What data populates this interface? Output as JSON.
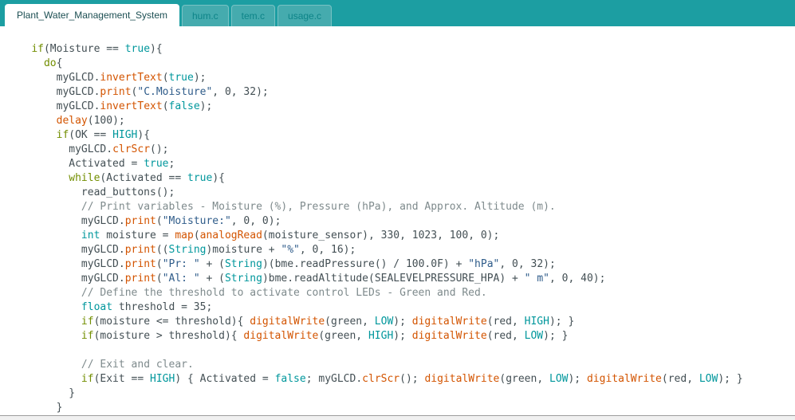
{
  "tabbar": {
    "tabs": [
      {
        "label": "Plant_Water_Management_System",
        "active": true
      },
      {
        "label": "hum.c",
        "active": false
      },
      {
        "label": "tem.c",
        "active": false
      },
      {
        "label": "usage.c",
        "active": false
      }
    ]
  },
  "colors": {
    "tabbar_bg": "#1C9EA2",
    "tab_active_bg": "#FFFFFF",
    "tab_active_text": "#1B4E52",
    "tab_inactive_bg": "#45ABAE",
    "tab_inactive_text": "#0D8488",
    "syntax": {
      "plain": "#434F54",
      "keyword": "#728E00",
      "type_literal": "#00979C",
      "function": "#D35400",
      "string": "#2F5C8A",
      "comment": "#7E8A8C"
    }
  },
  "code": {
    "lines": [
      [
        [
          "p",
          "    "
        ],
        [
          "k",
          "if"
        ],
        [
          "p",
          "(Moisture == "
        ],
        [
          "t",
          "true"
        ],
        [
          "p",
          "){"
        ]
      ],
      [
        [
          "p",
          "      "
        ],
        [
          "k",
          "do"
        ],
        [
          "p",
          "{"
        ]
      ],
      [
        [
          "p",
          "        myGLCD."
        ],
        [
          "f",
          "invertText"
        ],
        [
          "p",
          "("
        ],
        [
          "t",
          "true"
        ],
        [
          "p",
          ");"
        ]
      ],
      [
        [
          "p",
          "        myGLCD."
        ],
        [
          "f",
          "print"
        ],
        [
          "p",
          "("
        ],
        [
          "s",
          "\"C.Moisture\""
        ],
        [
          "p",
          ", 0, 32);"
        ]
      ],
      [
        [
          "p",
          "        myGLCD."
        ],
        [
          "f",
          "invertText"
        ],
        [
          "p",
          "("
        ],
        [
          "t",
          "false"
        ],
        [
          "p",
          ");"
        ]
      ],
      [
        [
          "p",
          "        "
        ],
        [
          "f",
          "delay"
        ],
        [
          "p",
          "(100);"
        ]
      ],
      [
        [
          "p",
          "        "
        ],
        [
          "k",
          "if"
        ],
        [
          "p",
          "(OK == "
        ],
        [
          "t",
          "HIGH"
        ],
        [
          "p",
          "){"
        ]
      ],
      [
        [
          "p",
          "          myGLCD."
        ],
        [
          "f",
          "clrScr"
        ],
        [
          "p",
          "();"
        ]
      ],
      [
        [
          "p",
          "          Activated = "
        ],
        [
          "t",
          "true"
        ],
        [
          "p",
          ";"
        ]
      ],
      [
        [
          "p",
          "          "
        ],
        [
          "k",
          "while"
        ],
        [
          "p",
          "(Activated == "
        ],
        [
          "t",
          "true"
        ],
        [
          "p",
          "){"
        ]
      ],
      [
        [
          "p",
          "            read_buttons();"
        ]
      ],
      [
        [
          "p",
          "            "
        ],
        [
          "c",
          "// Print variables - Moisture (%), Pressure (hPa), and Approx. Altitude (m)."
        ]
      ],
      [
        [
          "p",
          "            myGLCD."
        ],
        [
          "f",
          "print"
        ],
        [
          "p",
          "("
        ],
        [
          "s",
          "\"Moisture:\""
        ],
        [
          "p",
          ", 0, 0);"
        ]
      ],
      [
        [
          "p",
          "            "
        ],
        [
          "t",
          "int"
        ],
        [
          "p",
          " moisture = "
        ],
        [
          "f",
          "map"
        ],
        [
          "p",
          "("
        ],
        [
          "f",
          "analogRead"
        ],
        [
          "p",
          "(moisture_sensor), 330, 1023, 100, 0);"
        ]
      ],
      [
        [
          "p",
          "            myGLCD."
        ],
        [
          "f",
          "print"
        ],
        [
          "p",
          "(("
        ],
        [
          "t",
          "String"
        ],
        [
          "p",
          ")moisture + "
        ],
        [
          "s",
          "\"%\""
        ],
        [
          "p",
          ", 0, 16);"
        ]
      ],
      [
        [
          "p",
          "            myGLCD."
        ],
        [
          "f",
          "print"
        ],
        [
          "p",
          "("
        ],
        [
          "s",
          "\"Pr: \""
        ],
        [
          "p",
          " + ("
        ],
        [
          "t",
          "String"
        ],
        [
          "p",
          ")(bme.readPressure() / 100.0F) + "
        ],
        [
          "s",
          "\"hPa\""
        ],
        [
          "p",
          ", 0, 32);"
        ]
      ],
      [
        [
          "p",
          "            myGLCD."
        ],
        [
          "f",
          "print"
        ],
        [
          "p",
          "("
        ],
        [
          "s",
          "\"Al: \""
        ],
        [
          "p",
          " + ("
        ],
        [
          "t",
          "String"
        ],
        [
          "p",
          ")bme.readAltitude(SEALEVELPRESSURE_HPA) + "
        ],
        [
          "s",
          "\" m\""
        ],
        [
          "p",
          ", 0, 40);"
        ]
      ],
      [
        [
          "p",
          "            "
        ],
        [
          "c",
          "// Define the threshold to activate control LEDs - Green and Red."
        ]
      ],
      [
        [
          "p",
          "            "
        ],
        [
          "t",
          "float"
        ],
        [
          "p",
          " threshold = 35;"
        ]
      ],
      [
        [
          "p",
          "            "
        ],
        [
          "k",
          "if"
        ],
        [
          "p",
          "(moisture <= threshold){ "
        ],
        [
          "f",
          "digitalWrite"
        ],
        [
          "p",
          "(green, "
        ],
        [
          "t",
          "LOW"
        ],
        [
          "p",
          "); "
        ],
        [
          "f",
          "digitalWrite"
        ],
        [
          "p",
          "(red, "
        ],
        [
          "t",
          "HIGH"
        ],
        [
          "p",
          "); }"
        ]
      ],
      [
        [
          "p",
          "            "
        ],
        [
          "k",
          "if"
        ],
        [
          "p",
          "(moisture > threshold){ "
        ],
        [
          "f",
          "digitalWrite"
        ],
        [
          "p",
          "(green, "
        ],
        [
          "t",
          "HIGH"
        ],
        [
          "p",
          "); "
        ],
        [
          "f",
          "digitalWrite"
        ],
        [
          "p",
          "(red, "
        ],
        [
          "t",
          "LOW"
        ],
        [
          "p",
          "); }"
        ]
      ],
      [],
      [
        [
          "p",
          "            "
        ],
        [
          "c",
          "// Exit and clear."
        ]
      ],
      [
        [
          "p",
          "            "
        ],
        [
          "k",
          "if"
        ],
        [
          "p",
          "(Exit == "
        ],
        [
          "t",
          "HIGH"
        ],
        [
          "p",
          ") { Activated = "
        ],
        [
          "t",
          "false"
        ],
        [
          "p",
          "; myGLCD."
        ],
        [
          "f",
          "clrScr"
        ],
        [
          "p",
          "(); "
        ],
        [
          "f",
          "digitalWrite"
        ],
        [
          "p",
          "(green, "
        ],
        [
          "t",
          "LOW"
        ],
        [
          "p",
          "); "
        ],
        [
          "f",
          "digitalWrite"
        ],
        [
          "p",
          "(red, "
        ],
        [
          "t",
          "LOW"
        ],
        [
          "p",
          "); }"
        ]
      ],
      [
        [
          "p",
          "          }"
        ]
      ],
      [
        [
          "p",
          "        }"
        ]
      ]
    ]
  }
}
